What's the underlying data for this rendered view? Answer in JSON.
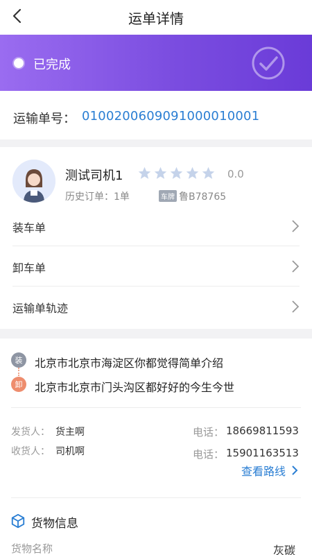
{
  "nav": {
    "title": "运单详情",
    "back_icon": "chevron-left-icon"
  },
  "status": {
    "text": "已完成",
    "icon": "check-circle-icon"
  },
  "order": {
    "label": "运输单号：",
    "number": "01002006090910000100​01"
  },
  "driver": {
    "name": "测试司机1",
    "rating_value": "0.0",
    "rating_stars": 0,
    "history": "历史订单：1单",
    "plate_tag": "车牌",
    "plate": "鲁B78765"
  },
  "menu": {
    "items": [
      {
        "label": "装车单"
      },
      {
        "label": "卸车单"
      },
      {
        "label": "运输单轨迹"
      }
    ]
  },
  "route": {
    "load_badge": "装",
    "load_address": "北京市北京市海淀区你都觉得简单介绍",
    "unload_badge": "卸",
    "unload_address": "北京市北京市门头沟区都好好的今生今世",
    "shipper_label": "发货人：",
    "shipper_name": "货主啊",
    "shipper_phone_label": "电话：",
    "shipper_phone": "18669811593",
    "receiver_label": "收货人：",
    "receiver_name": "司机啊",
    "receiver_phone_label": "电话：",
    "receiver_phone": "15901163513",
    "view_route": "查看路线"
  },
  "cargo": {
    "title": "货物信息",
    "name_label": "货物名称",
    "name_value": "灰碳"
  },
  "colors": {
    "accent_blue": "#2a7ed3",
    "banner_start": "#9a6cf0",
    "banner_end": "#6a3bd8",
    "load_badge": "#8e95a3",
    "unload_badge": "#ee8d6e",
    "star": "#c5d3ea"
  }
}
